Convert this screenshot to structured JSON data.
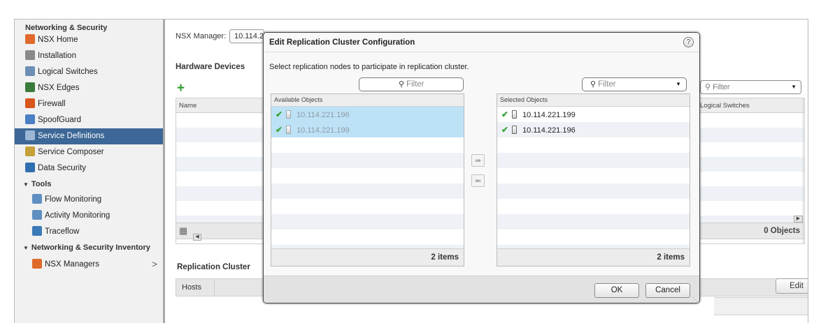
{
  "sidebar": {
    "title": "Networking & Security",
    "items": [
      {
        "label": "NSX Home",
        "icon": "nsx-home-icon",
        "color": "#e06a2c"
      },
      {
        "label": "Installation",
        "icon": "installation-icon",
        "color": "#8a8a8a"
      },
      {
        "label": "Logical Switches",
        "icon": "logical-switches-icon",
        "color": "#6d8fb5"
      },
      {
        "label": "NSX Edges",
        "icon": "nsx-edges-icon",
        "color": "#3a7a3a"
      },
      {
        "label": "Firewall",
        "icon": "firewall-icon",
        "color": "#d8561c"
      },
      {
        "label": "SpoofGuard",
        "icon": "spoofguard-icon",
        "color": "#4b7fc6"
      },
      {
        "label": "Service Definitions",
        "icon": "service-definitions-icon",
        "color": "#9bb7d4"
      },
      {
        "label": "Service Composer",
        "icon": "service-composer-icon",
        "color": "#c4a13a"
      },
      {
        "label": "Data Security",
        "icon": "data-security-icon",
        "color": "#2f6fb1"
      }
    ],
    "tools_group": "Tools",
    "tools": [
      {
        "label": "Flow Monitoring",
        "icon": "flow-monitoring-icon",
        "color": "#5f8fc0"
      },
      {
        "label": "Activity Monitoring",
        "icon": "activity-monitoring-icon",
        "color": "#5f8fc0"
      },
      {
        "label": "Traceflow",
        "icon": "traceflow-icon",
        "color": "#3b7ab8"
      }
    ],
    "inventory_group": "Networking & Security Inventory",
    "inventory": [
      {
        "label": "NSX Managers",
        "icon": "nsx-managers-icon",
        "color": "#e06a2c"
      }
    ],
    "active_index": 6
  },
  "main": {
    "manager_label": "NSX Manager:",
    "manager_value": "10.114.2",
    "hardware_title": "Hardware Devices",
    "grid_name_header": "Name",
    "right_filter_placeholder": "Filter",
    "right_grid_header": "Logical Switches",
    "object_count": "0 Objects",
    "replication_title": "Replication Cluster",
    "hosts_label": "Hosts",
    "edit_label": "Edit"
  },
  "dialog": {
    "title": "Edit Replication Cluster Configuration",
    "help": "?",
    "instruction": "Select replication nodes to participate in replication cluster.",
    "left_filter": "Filter",
    "right_filter": "Filter",
    "available": {
      "header": "Available Objects",
      "items": [
        "10.114.221.196",
        "10.114.221.199"
      ],
      "count": "2 items"
    },
    "selected": {
      "header": "Selected Objects",
      "items": [
        "10.114.221.199",
        "10.114.221.196"
      ],
      "count": "2 items"
    },
    "ok_label": "OK",
    "cancel_label": "Cancel"
  }
}
